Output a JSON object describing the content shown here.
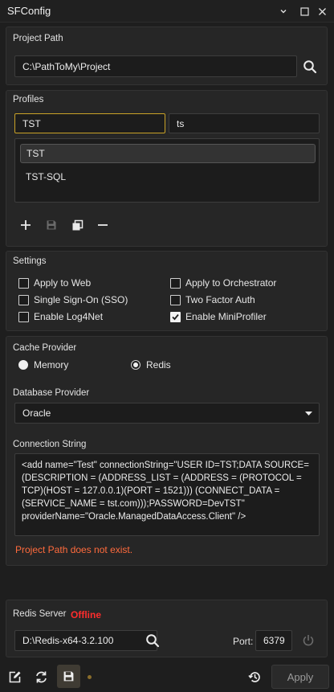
{
  "window": {
    "title": "SFConfig"
  },
  "project_path": {
    "label": "Project Path",
    "value": "C:\\PathToMy\\Project"
  },
  "profiles": {
    "label": "Profiles",
    "name_value": "TST",
    "secondary_value": "ts",
    "items": [
      {
        "label": "TST",
        "selected": true
      },
      {
        "label": "TST-SQL",
        "selected": false
      }
    ]
  },
  "settings": {
    "label": "Settings",
    "options": [
      {
        "label": "Apply to Web",
        "checked": true
      },
      {
        "label": "Apply to Orchestrator",
        "checked": false
      },
      {
        "label": "Single Sign-On (SSO)",
        "checked": false
      },
      {
        "label": "Two Factor Auth",
        "checked": false
      },
      {
        "label": "Enable Log4Net",
        "checked": false
      },
      {
        "label": "Enable MiniProfiler",
        "checked": true
      }
    ]
  },
  "cache_provider": {
    "label": "Cache Provider",
    "options": [
      {
        "label": "Memory",
        "selected": false
      },
      {
        "label": "Redis",
        "selected": true
      }
    ]
  },
  "database_provider": {
    "label": "Database Provider",
    "selected": "Oracle"
  },
  "connection_string": {
    "label": "Connection String",
    "value": "<add name=\"Test\" connectionString=\"USER ID=TST;DATA SOURCE=(DESCRIPTION = (ADDRESS_LIST = (ADDRESS = (PROTOCOL = TCP)(HOST = 127.0.0.1)(PORT = 1521))) (CONNECT_DATA = (SERVICE_NAME = tst.com)));PASSWORD=DevTST\" providerName=\"Oracle.ManagedDataAccess.Client\" />"
  },
  "error_message": "Project Path does not exist.",
  "redis": {
    "label": "Redis Server",
    "status": "Offline",
    "path": "D:\\Redis-x64-3.2.100",
    "port_label": "Port:",
    "port": "6379"
  },
  "footer": {
    "apply_label": "Apply"
  },
  "colors": {
    "accent_focus": "#c9a227",
    "error": "#ff6b3d",
    "offline": "#ff2d2d"
  }
}
